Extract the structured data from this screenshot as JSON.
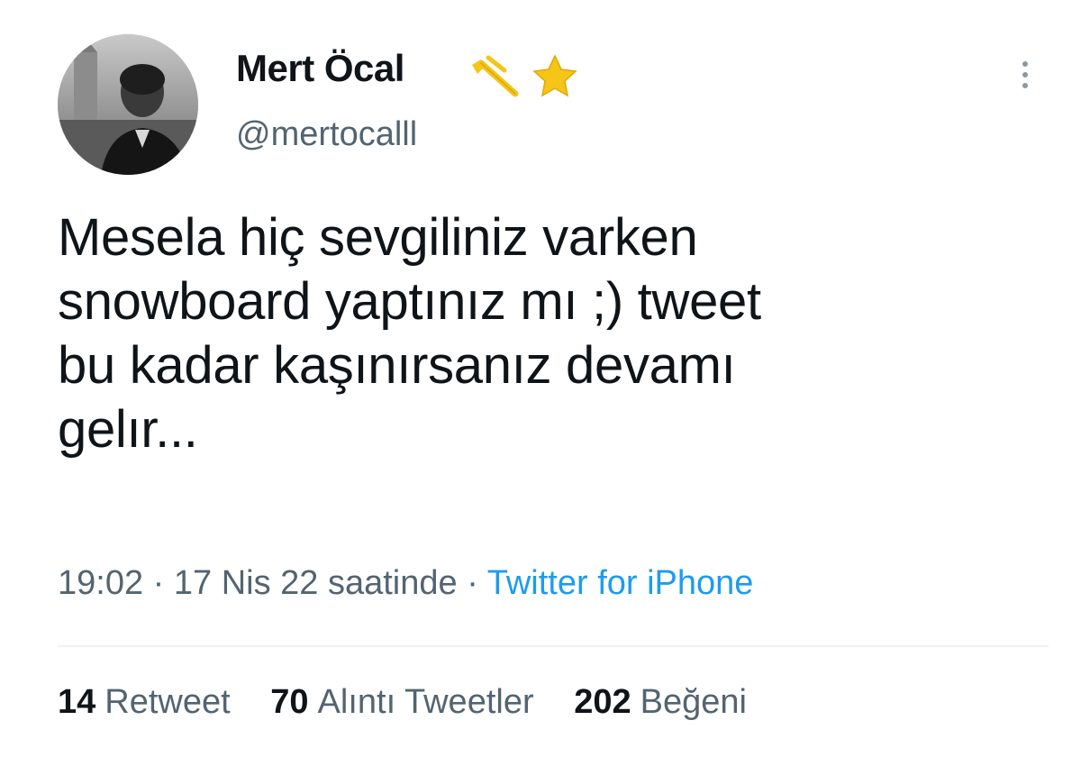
{
  "tweet": {
    "author": {
      "display_name": "Mert Öcal",
      "handle": "@mertocalll",
      "name_emojis": [
        "ski-pole-emoji",
        "star-emoji"
      ]
    },
    "text": "Mesela hiç sevgiliniz varken\nsnowboard yaptınız mı ;) tweet\nbu kadar kaşınırsanız devamı\ngelır...",
    "time": "19:02",
    "date": "17 Nis 22 saatinde",
    "separator": "·",
    "source": "Twitter for iPhone",
    "stats": {
      "retweets": {
        "count": "14",
        "label": "Retweet"
      },
      "quotes": {
        "count": "70",
        "label": "Alıntı Tweetler"
      },
      "likes": {
        "count": "202",
        "label": "Beğeni"
      }
    }
  },
  "colors": {
    "text_primary": "#0f1419",
    "text_secondary": "#536471",
    "link": "#1d9bf0",
    "divider": "#eff3f4",
    "star": "#f5c518"
  },
  "icons": {
    "more": "more-options-icon"
  }
}
